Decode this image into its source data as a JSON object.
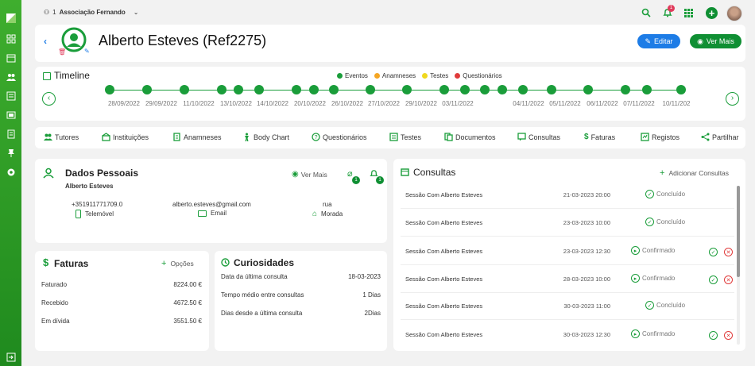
{
  "org": {
    "index": "1",
    "name": "Associação Fernando"
  },
  "notifications": {
    "count": "1"
  },
  "patient": {
    "title": "Alberto Esteves (Ref2275)"
  },
  "header_buttons": {
    "edit": "Editar",
    "more": "Ver Mais"
  },
  "timeline": {
    "title": "Timeline",
    "legend": [
      {
        "label": "Eventos",
        "color": "#1a9d3a"
      },
      {
        "label": "Anamneses",
        "color": "#f5a623"
      },
      {
        "label": "Testes",
        "color": "#f0d81e"
      },
      {
        "label": "Questionários",
        "color": "#e03b3b"
      }
    ],
    "dates": [
      "28/09/2022",
      "29/09/2022",
      "11/10/2022",
      "13/10/2022",
      "14/10/2022",
      "20/10/2022",
      "26/10/2022",
      "27/10/2022",
      "29/10/2022",
      "03/11/2022",
      "04/11/2022",
      "05/11/2022",
      "06/11/2022",
      "07/11/2022",
      "10/11/202"
    ]
  },
  "tabs": [
    "Tutores",
    "Instituições",
    "Anamneses",
    "Body Chart",
    "Questionários",
    "Testes",
    "Documentos",
    "Consultas",
    "Faturas",
    "Registos",
    "Partilhar"
  ],
  "personal": {
    "title": "Dados Pessoais",
    "name": "Alberto Esteves",
    "more": "Ver Mais",
    "attach_count": "1",
    "bell_count": "1",
    "phone": "+351911771709.0",
    "phone_label": "Telemóvel",
    "email": "alberto.esteves@gmail.com",
    "email_label": "Email",
    "address": "rua",
    "address_label": "Morada"
  },
  "invoices": {
    "title": "Faturas",
    "options": "Opções",
    "rows": [
      {
        "label": "Faturado",
        "value": "8224.00 €"
      },
      {
        "label": "Recebido",
        "value": "4672.50 €"
      },
      {
        "label": "Em dívida",
        "value": "3551.50 €"
      }
    ]
  },
  "curiosities": {
    "title": "Curiosidades",
    "rows": [
      {
        "label": "Data da última consulta",
        "value": "18-03-2023"
      },
      {
        "label": "Tempo médio entre consultas",
        "value": "1 Dias"
      },
      {
        "label": "Dias desde a última consulta",
        "value": "2Dias"
      }
    ]
  },
  "consults": {
    "title": "Consultas",
    "add": "Adicionar Consultas",
    "rows": [
      {
        "session": "Sessão Com Alberto Esteves",
        "date": "21-03-2023 20:00",
        "status": "Concluído"
      },
      {
        "session": "Sessão Com Alberto Esteves",
        "date": "23-03-2023 10:00",
        "status": "Concluído"
      },
      {
        "session": "Sessão Com Alberto Esteves",
        "date": "23-03-2023 12:30",
        "status": "Confirmado"
      },
      {
        "session": "Sessão Com Alberto Esteves",
        "date": "28-03-2023 10:00",
        "status": "Confirmado"
      },
      {
        "session": "Sessão Com Alberto Esteves",
        "date": "30-03-2023 11:00",
        "status": "Concluído"
      },
      {
        "session": "Sessão Com Alberto Esteves",
        "date": "30-03-2023 12:30",
        "status": "Confirmado"
      }
    ]
  }
}
